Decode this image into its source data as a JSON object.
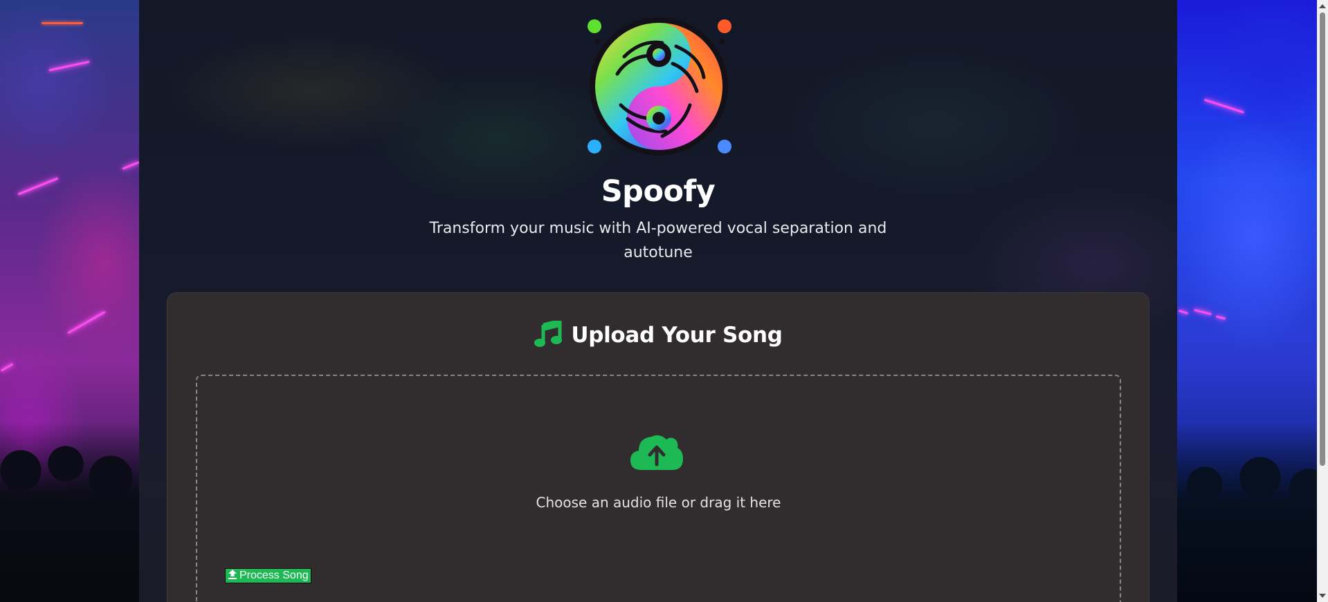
{
  "app": {
    "title": "Spoofy",
    "subtitle": "Transform your music with AI-powered vocal separation and autotune",
    "logo_icon": "yin-yang-music-logo"
  },
  "upload": {
    "title": "Upload Your Song",
    "title_icon": "music-note-icon",
    "drop_text": "Choose an audio file or drag it here",
    "drop_icon": "cloud-upload-icon",
    "process_label": "Process Song",
    "process_icon": "upload-icon"
  },
  "colors": {
    "accent_green": "#1db954",
    "card_bg": "#312d2e",
    "page_bg": "#151a2a"
  }
}
